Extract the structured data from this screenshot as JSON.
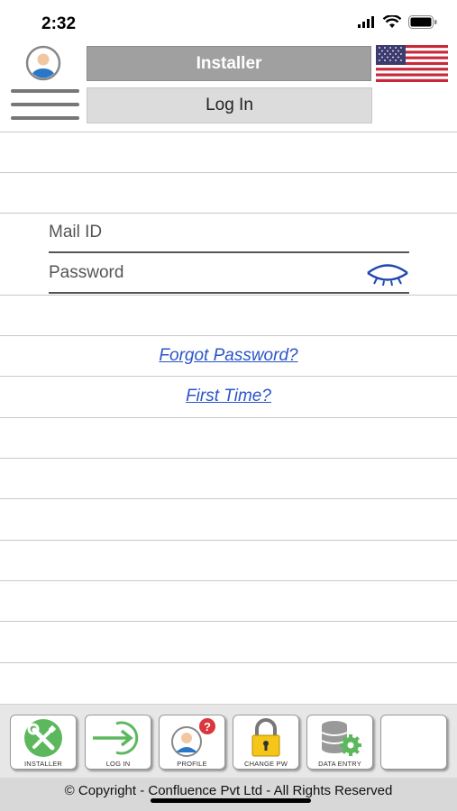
{
  "status_bar": {
    "time": "2:32"
  },
  "header": {
    "installer_label": "Installer",
    "login_label": "Log In"
  },
  "form": {
    "mail_placeholder": "Mail ID",
    "password_placeholder": "Password"
  },
  "links": {
    "forgot_password": "Forgot Password?",
    "first_time": "First Time?"
  },
  "toolbar": {
    "items": [
      {
        "label": "INSTALLER",
        "icon": "wrench-icon"
      },
      {
        "label": "LOG IN",
        "icon": "login-arrow-icon"
      },
      {
        "label": "PROFILE",
        "icon": "profile-help-icon"
      },
      {
        "label": "CHANGE PW",
        "icon": "padlock-icon"
      },
      {
        "label": "DATA ENTRY",
        "icon": "database-gear-icon"
      },
      {
        "label": "",
        "icon": ""
      }
    ]
  },
  "footer": {
    "copyright": "© Copyright - Confluence Pvt Ltd - All Rights Reserved"
  },
  "colors": {
    "link": "#2a55c8",
    "installer_bg": "#a0a0a0",
    "login_bg": "#dcdcdc",
    "toolbar_bg": "#e7e7e7",
    "icon_green": "#5cb85c"
  }
}
